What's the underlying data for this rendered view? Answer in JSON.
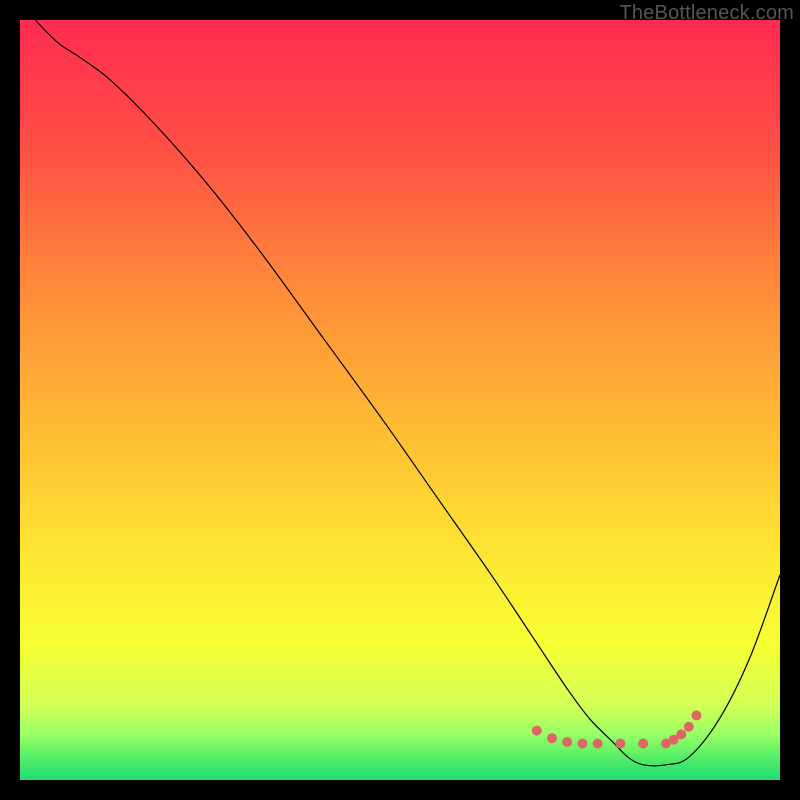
{
  "watermark": "TheBottleneck.com",
  "chart_data": {
    "type": "line",
    "title": "",
    "xlabel": "",
    "ylabel": "",
    "xlim": [
      0,
      100
    ],
    "ylim": [
      0,
      100
    ],
    "grid": false,
    "series": [
      {
        "name": "curve",
        "color": "#000000",
        "stroke_width": 1.2,
        "x": [
          2,
          5,
          8,
          12,
          18,
          25,
          32,
          40,
          48,
          55,
          62,
          68,
          72,
          75,
          78,
          80,
          82,
          85,
          88,
          92,
          96,
          100
        ],
        "y": [
          100,
          97,
          95,
          92,
          86,
          78,
          69,
          58,
          47,
          37,
          27,
          18,
          12,
          8,
          5,
          3,
          2,
          2,
          3,
          8,
          16,
          27
        ]
      },
      {
        "name": "markers",
        "color": "#e06666",
        "type": "scatter",
        "marker_size": 7,
        "x": [
          68,
          70,
          72,
          74,
          76,
          79,
          82,
          85,
          86,
          87,
          88,
          89
        ],
        "y": [
          6.5,
          5.5,
          5,
          4.8,
          4.8,
          4.8,
          4.8,
          4.8,
          5.3,
          6,
          7,
          8.5
        ]
      }
    ],
    "background_gradient": {
      "type": "linear-vertical",
      "stops": [
        {
          "offset": 0.0,
          "color": "#ff2b52"
        },
        {
          "offset": 0.18,
          "color": "#ff5244"
        },
        {
          "offset": 0.35,
          "color": "#ff8a3a"
        },
        {
          "offset": 0.52,
          "color": "#ffb733"
        },
        {
          "offset": 0.68,
          "color": "#ffe033"
        },
        {
          "offset": 0.82,
          "color": "#f7ff33"
        },
        {
          "offset": 0.9,
          "color": "#d4ff55"
        },
        {
          "offset": 0.94,
          "color": "#99ff66"
        },
        {
          "offset": 0.97,
          "color": "#55ee66"
        },
        {
          "offset": 1.0,
          "color": "#22dd77"
        }
      ]
    }
  }
}
